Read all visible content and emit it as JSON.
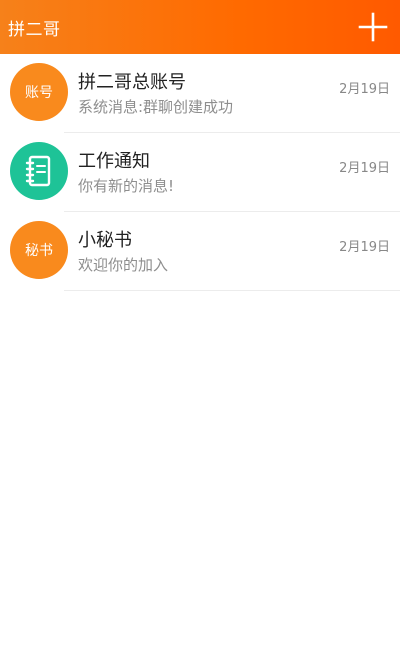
{
  "header": {
    "title": "拼二哥",
    "add_icon": "plus-icon"
  },
  "colors": {
    "header_start": "#f6811a",
    "header_end": "#ff5a00",
    "avatar_orange": "#f98a1d",
    "avatar_teal": "#1ec397"
  },
  "conversations": [
    {
      "avatar_text": "账号",
      "avatar_icon": "",
      "title": "拼二哥总账号",
      "message": "系统消息:群聊创建成功",
      "time": "2月19日"
    },
    {
      "avatar_text": "",
      "avatar_icon": "notebook-icon",
      "title": "工作通知",
      "message": "你有新的消息!",
      "time": "2月19日"
    },
    {
      "avatar_text": "秘书",
      "avatar_icon": "",
      "title": "小秘书",
      "message": "欢迎你的加入",
      "time": "2月19日"
    }
  ]
}
